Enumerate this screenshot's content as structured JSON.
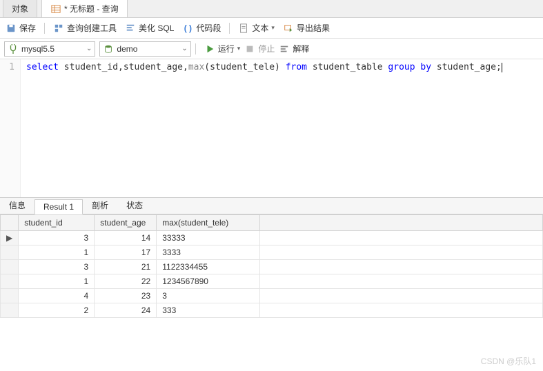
{
  "tabs": {
    "object": "对象",
    "query": "* 无标题 - 查询"
  },
  "toolbar": {
    "save": "保存",
    "query_builder": "查询创建工具",
    "beautify": "美化 SQL",
    "snippet": "代码段",
    "text": "文本",
    "export": "导出结果"
  },
  "connection": {
    "conn_name": "mysql5.5",
    "db_name": "demo",
    "run": "运行",
    "stop": "停止",
    "explain": "解释"
  },
  "editor": {
    "line_number": "1",
    "tokens": {
      "select": "select",
      "cols": " student_id,student_age,",
      "max": "max",
      "maxarg": "(student_tele) ",
      "from": "from",
      "table": " student_table ",
      "group": "group",
      "sp": " ",
      "by": "by",
      "tail": " student_age;"
    }
  },
  "result_tabs": {
    "info": "信息",
    "result1": "Result 1",
    "profile": "剖析",
    "status": "状态"
  },
  "grid": {
    "headers": {
      "c1": "student_id",
      "c2": "student_age",
      "c3": "max(student_tele)"
    },
    "rows": [
      {
        "indicator": "▶",
        "c1": "3",
        "c2": "14",
        "c3": "33333"
      },
      {
        "indicator": "",
        "c1": "1",
        "c2": "17",
        "c3": "3333"
      },
      {
        "indicator": "",
        "c1": "3",
        "c2": "21",
        "c3": "1122334455"
      },
      {
        "indicator": "",
        "c1": "1",
        "c2": "22",
        "c3": "1234567890"
      },
      {
        "indicator": "",
        "c1": "4",
        "c2": "23",
        "c3": "3"
      },
      {
        "indicator": "",
        "c1": "2",
        "c2": "24",
        "c3": "333"
      }
    ]
  },
  "watermark": "CSDN @乐队1"
}
